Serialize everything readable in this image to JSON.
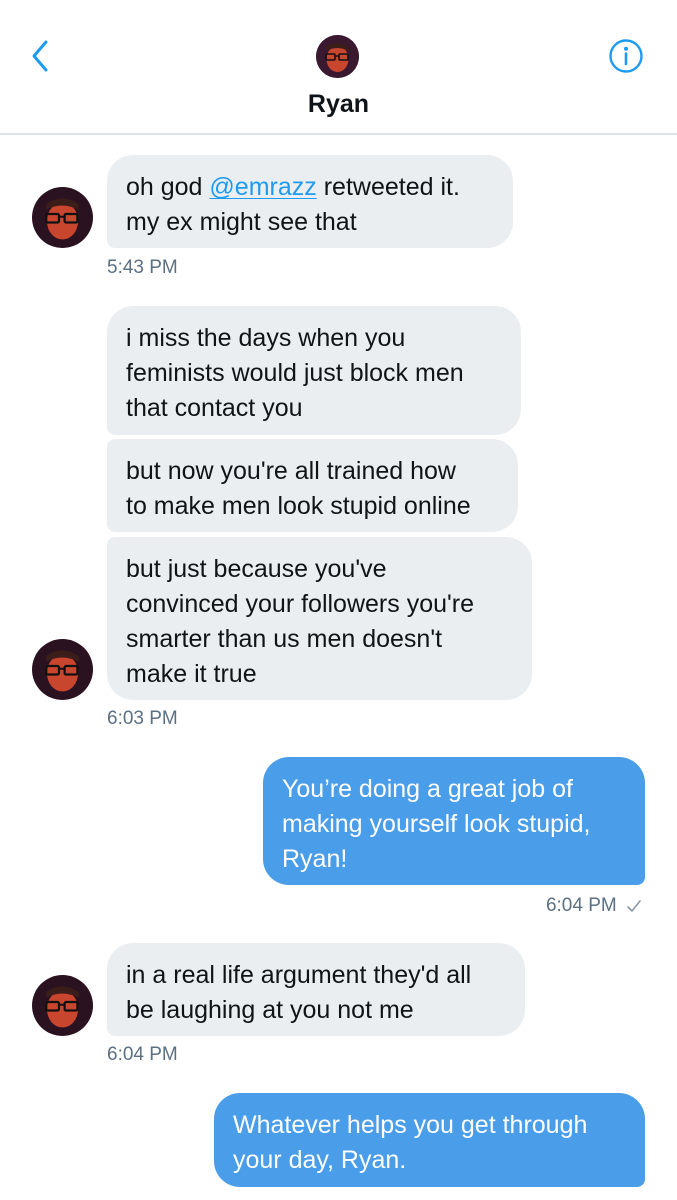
{
  "header": {
    "back_icon": "chevron-left-icon",
    "title": "Ryan",
    "info_icon": "info-circle-icon",
    "accent_color": "#1d9bf0"
  },
  "messages": [
    {
      "direction": "incoming",
      "parts": [
        "oh god ",
        "@emrazz",
        " retweeted it."
      ],
      "line2": "my ex might see that",
      "time": "5:43 PM"
    },
    {
      "direction": "incoming",
      "lines": [
        "i miss the days when you",
        "feminists would just block men",
        "that contact you"
      ]
    },
    {
      "direction": "incoming",
      "lines": [
        "but now you're all trained how",
        "to make men look stupid online"
      ]
    },
    {
      "direction": "incoming",
      "lines": [
        "but just because you've",
        "convinced your followers you're",
        "smarter than us men doesn't",
        "make it true"
      ],
      "time": "6:03 PM"
    },
    {
      "direction": "outgoing",
      "lines": [
        "You’re doing a great job of",
        "making yourself look stupid,",
        "Ryan!"
      ],
      "time": "6:04 PM",
      "status_icon": "sent-check-icon"
    },
    {
      "direction": "incoming",
      "lines": [
        "in a real life argument they'd all",
        "be laughing at you not me"
      ],
      "time": "6:04 PM"
    },
    {
      "direction": "outgoing",
      "lines": [
        "Whatever helps you get through",
        "your day, Ryan."
      ]
    }
  ],
  "colors": {
    "incoming_bubble": "#ebeef0",
    "outgoing_bubble": "#4a9de8",
    "timestamp": "#5b7083"
  }
}
